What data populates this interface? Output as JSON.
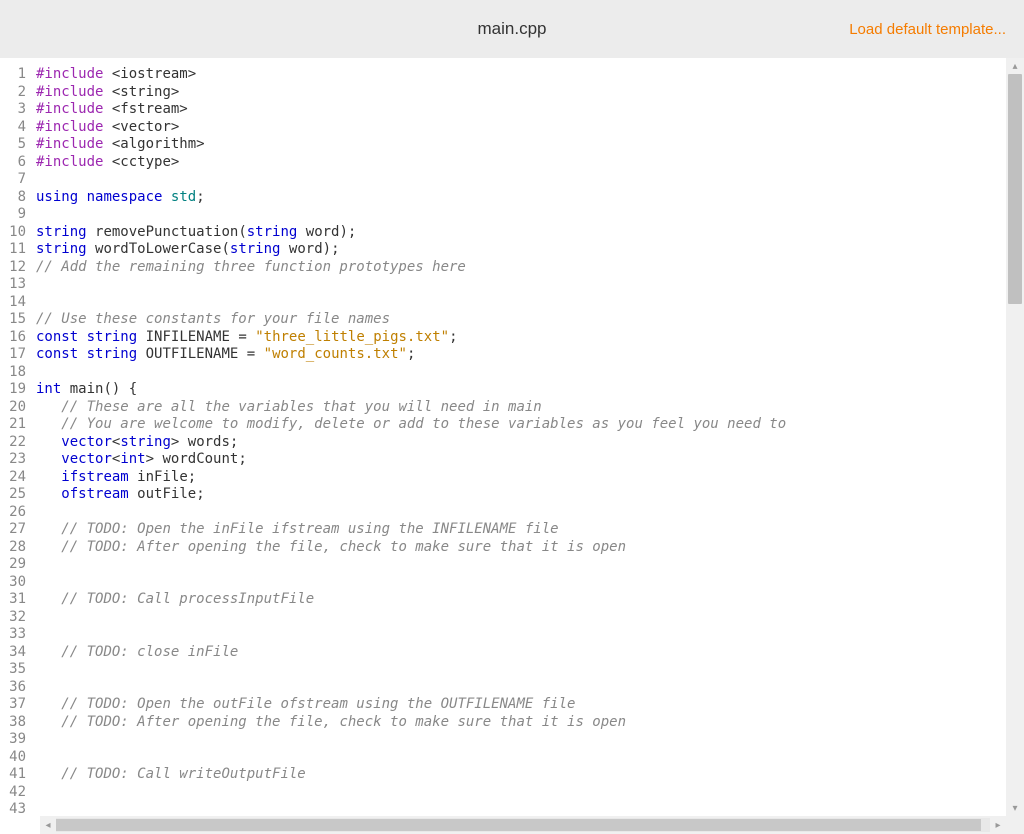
{
  "header": {
    "filename": "main.cpp",
    "load_template_label": "Load default template..."
  },
  "code": {
    "line_start": 1,
    "lines": [
      [
        [
          "pre",
          "#include"
        ],
        [
          "sp",
          " "
        ],
        [
          "inc",
          "<iostream>"
        ]
      ],
      [
        [
          "pre",
          "#include"
        ],
        [
          "sp",
          " "
        ],
        [
          "inc",
          "<string>"
        ]
      ],
      [
        [
          "pre",
          "#include"
        ],
        [
          "sp",
          " "
        ],
        [
          "inc",
          "<fstream>"
        ]
      ],
      [
        [
          "pre",
          "#include"
        ],
        [
          "sp",
          " "
        ],
        [
          "inc",
          "<vector>"
        ]
      ],
      [
        [
          "pre",
          "#include"
        ],
        [
          "sp",
          " "
        ],
        [
          "inc",
          "<algorithm>"
        ]
      ],
      [
        [
          "pre",
          "#include"
        ],
        [
          "sp",
          " "
        ],
        [
          "inc",
          "<cctype>"
        ]
      ],
      [],
      [
        [
          "key",
          "using"
        ],
        [
          "sp",
          " "
        ],
        [
          "key",
          "namespace"
        ],
        [
          "sp",
          " "
        ],
        [
          "ns",
          "std"
        ],
        [
          "punc",
          ";"
        ]
      ],
      [],
      [
        [
          "type",
          "string"
        ],
        [
          "sp",
          " "
        ],
        [
          "fn",
          "removePunctuation"
        ],
        [
          "paren",
          "("
        ],
        [
          "type",
          "string"
        ],
        [
          "sp",
          " "
        ],
        [
          "id",
          "word"
        ],
        [
          "paren",
          ")"
        ],
        [
          "punc",
          ";"
        ]
      ],
      [
        [
          "type",
          "string"
        ],
        [
          "sp",
          " "
        ],
        [
          "fn",
          "wordToLowerCase"
        ],
        [
          "paren",
          "("
        ],
        [
          "type",
          "string"
        ],
        [
          "sp",
          " "
        ],
        [
          "id",
          "word"
        ],
        [
          "paren",
          ")"
        ],
        [
          "punc",
          ";"
        ]
      ],
      [
        [
          "cmt",
          "// Add the remaining three function prototypes here"
        ]
      ],
      [],
      [],
      [
        [
          "cmt",
          "// Use these constants for your file names"
        ]
      ],
      [
        [
          "key",
          "const"
        ],
        [
          "sp",
          " "
        ],
        [
          "type",
          "string"
        ],
        [
          "sp",
          " "
        ],
        [
          "id",
          "INFILENAME"
        ],
        [
          "sp",
          " "
        ],
        [
          "punc",
          "="
        ],
        [
          "sp",
          " "
        ],
        [
          "str",
          "\"three_little_pigs.txt\""
        ],
        [
          "punc",
          ";"
        ]
      ],
      [
        [
          "key",
          "const"
        ],
        [
          "sp",
          " "
        ],
        [
          "type",
          "string"
        ],
        [
          "sp",
          " "
        ],
        [
          "id",
          "OUTFILENAME"
        ],
        [
          "sp",
          " "
        ],
        [
          "punc",
          "="
        ],
        [
          "sp",
          " "
        ],
        [
          "str",
          "\"word_counts.txt\""
        ],
        [
          "punc",
          ";"
        ]
      ],
      [],
      [
        [
          "key",
          "int"
        ],
        [
          "sp",
          " "
        ],
        [
          "fn",
          "main"
        ],
        [
          "paren",
          "()"
        ],
        [
          "sp",
          " "
        ],
        [
          "punc",
          "{"
        ]
      ],
      [
        [
          "sp",
          "   "
        ],
        [
          "cmt",
          "// These are all the variables that you will need in main"
        ]
      ],
      [
        [
          "sp",
          "   "
        ],
        [
          "cmt",
          "// You are welcome to modify, delete or add to these variables as you feel you need to"
        ]
      ],
      [
        [
          "sp",
          "   "
        ],
        [
          "type",
          "vector"
        ],
        [
          "punc",
          "<"
        ],
        [
          "type",
          "string"
        ],
        [
          "punc",
          ">"
        ],
        [
          "sp",
          " "
        ],
        [
          "id",
          "words"
        ],
        [
          "punc",
          ";"
        ]
      ],
      [
        [
          "sp",
          "   "
        ],
        [
          "type",
          "vector"
        ],
        [
          "punc",
          "<"
        ],
        [
          "key",
          "int"
        ],
        [
          "punc",
          ">"
        ],
        [
          "sp",
          " "
        ],
        [
          "id",
          "wordCount"
        ],
        [
          "punc",
          ";"
        ]
      ],
      [
        [
          "sp",
          "   "
        ],
        [
          "type",
          "ifstream"
        ],
        [
          "sp",
          " "
        ],
        [
          "id",
          "inFile"
        ],
        [
          "punc",
          ";"
        ]
      ],
      [
        [
          "sp",
          "   "
        ],
        [
          "type",
          "ofstream"
        ],
        [
          "sp",
          " "
        ],
        [
          "id",
          "outFile"
        ],
        [
          "punc",
          ";"
        ]
      ],
      [],
      [
        [
          "sp",
          "   "
        ],
        [
          "cmt",
          "// TODO: Open the inFile ifstream using the INFILENAME file"
        ]
      ],
      [
        [
          "sp",
          "   "
        ],
        [
          "cmt",
          "// TODO: After opening the file, check to make sure that it is open"
        ]
      ],
      [],
      [],
      [
        [
          "sp",
          "   "
        ],
        [
          "cmt",
          "// TODO: Call processInputFile"
        ]
      ],
      [],
      [],
      [
        [
          "sp",
          "   "
        ],
        [
          "cmt",
          "// TODO: close inFile"
        ]
      ],
      [],
      [],
      [
        [
          "sp",
          "   "
        ],
        [
          "cmt",
          "// TODO: Open the outFile ofstream using the OUTFILENAME file"
        ]
      ],
      [
        [
          "sp",
          "   "
        ],
        [
          "cmt",
          "// TODO: After opening the file, check to make sure that it is open"
        ]
      ],
      [],
      [],
      [
        [
          "sp",
          "   "
        ],
        [
          "cmt",
          "// TODO: Call writeOutputFile"
        ]
      ],
      [],
      []
    ]
  }
}
